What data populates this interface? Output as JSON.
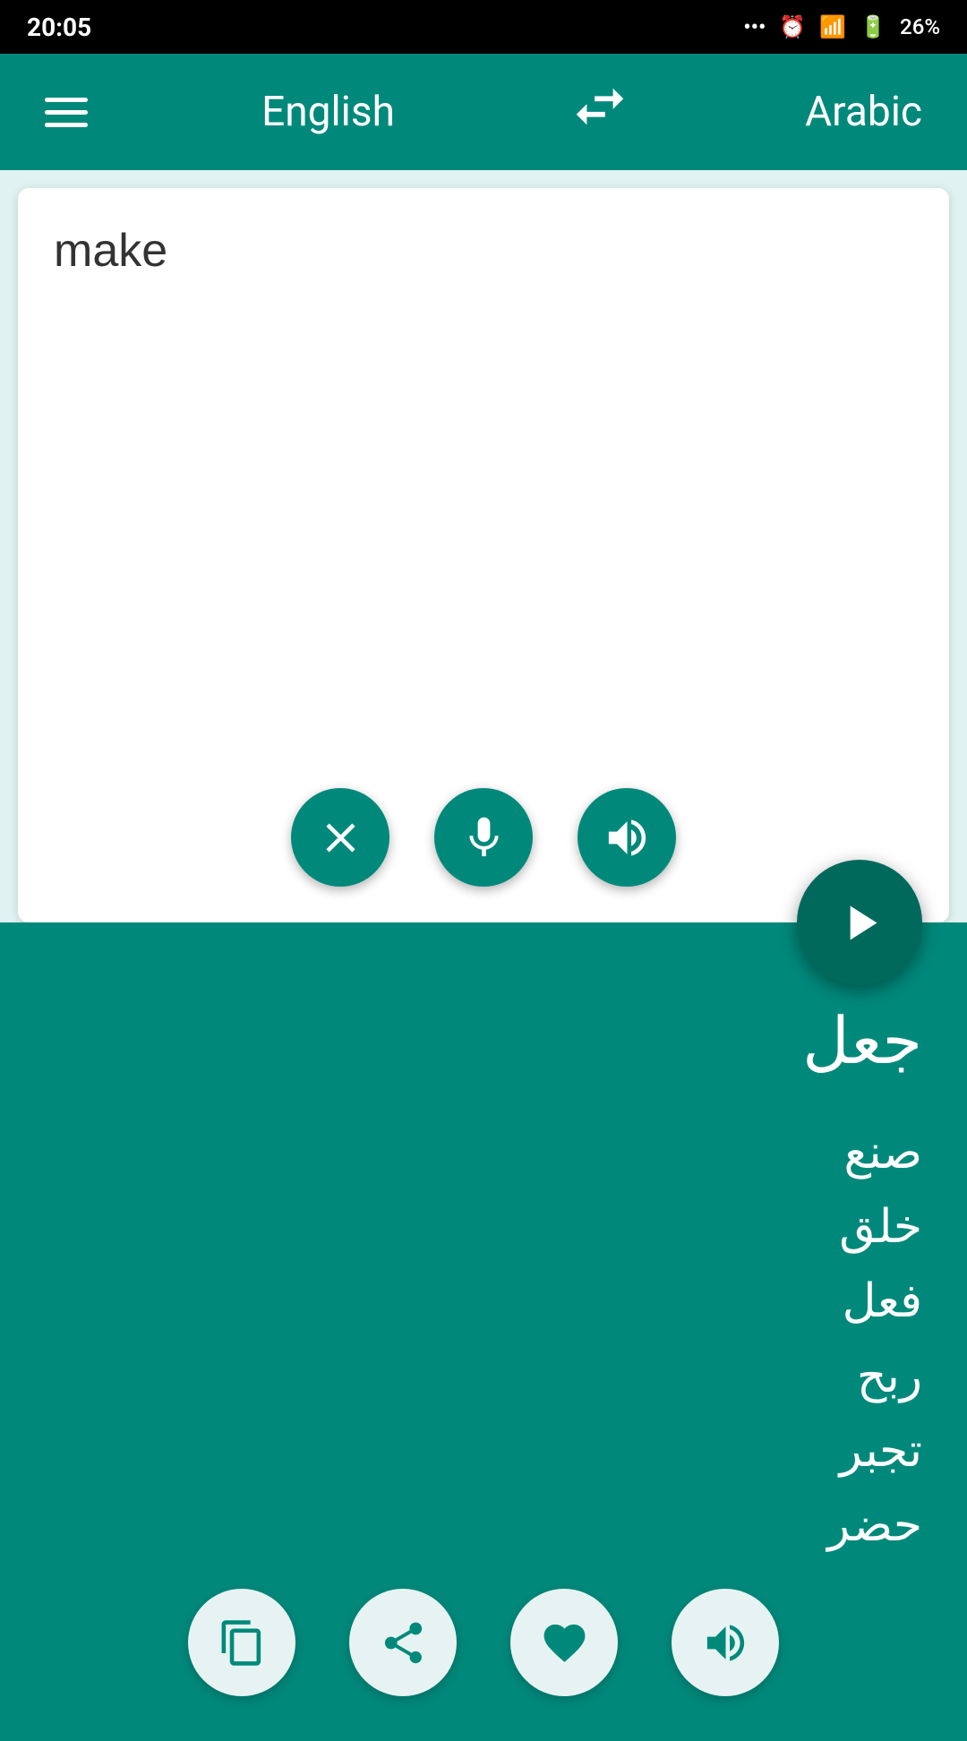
{
  "statusBar": {
    "time": "20:05",
    "dots": "...",
    "battery": "26%"
  },
  "toolbar": {
    "menuIcon": "menu",
    "sourceLang": "English",
    "swapIcon": "swap",
    "targetLang": "Arabic"
  },
  "sourcPanel": {
    "inputText": "make",
    "placeholder": "",
    "clearLabel": "clear",
    "micLabel": "microphone",
    "speakerLabel": "speak"
  },
  "translateButton": {
    "label": "translate"
  },
  "targetPanel": {
    "mainTranslation": "جعل",
    "alternativeTranslations": "صنع\nخلق\nفعل\nربح\nتجبر\nحضر",
    "copyLabel": "copy",
    "shareLabel": "share",
    "favoriteLabel": "favorite",
    "speakLabel": "speak"
  }
}
